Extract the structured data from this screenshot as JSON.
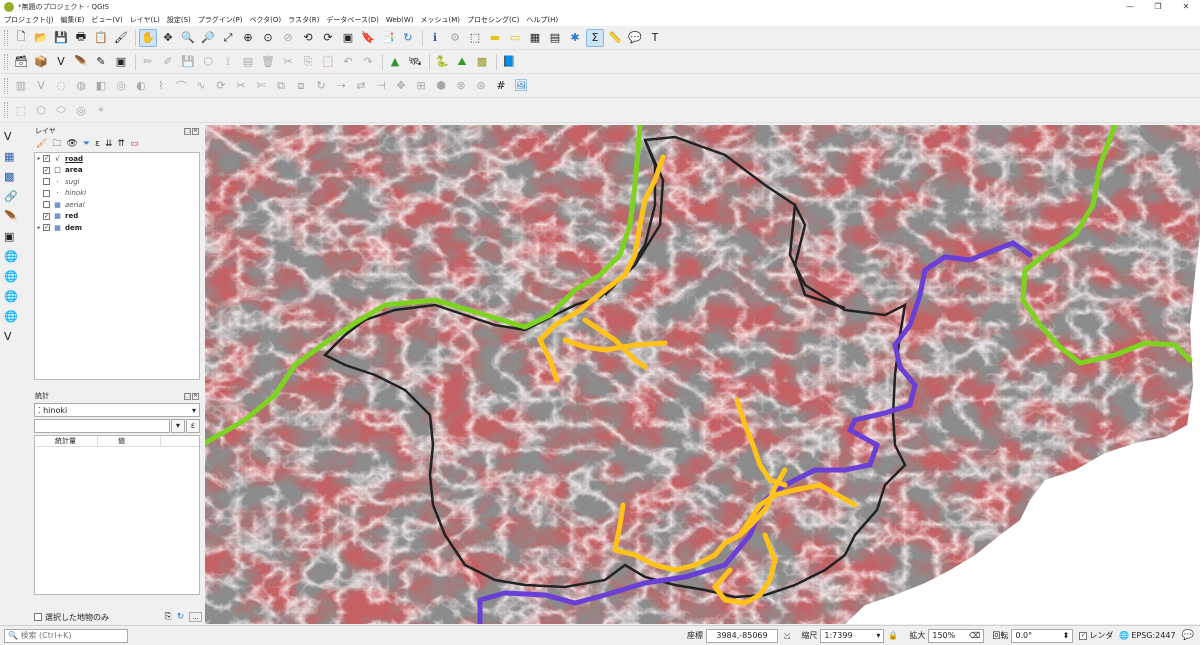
{
  "window": {
    "title": "*無題のプロジェクト - QGIS",
    "controls": [
      "—",
      "❐",
      "✕"
    ]
  },
  "menu": [
    "プロジェクト(J)",
    "編集(E)",
    "ビュー(V)",
    "レイヤ(L)",
    "設定(S)",
    "プラグイン(P)",
    "ベクタ(O)",
    "ラスタ(R)",
    "データベース(D)",
    "Web(W)",
    "メッシュ(M)",
    "プロセシング(C)",
    "ヘルプ(H)"
  ],
  "layers_panel": {
    "title": "レイヤ",
    "layers": [
      {
        "name": "road",
        "checked": true,
        "icon": "line-layer-icon",
        "style": "bold under",
        "expandable": true
      },
      {
        "name": "area",
        "checked": true,
        "icon": "polygon-layer-icon",
        "style": "bold",
        "expandable": false
      },
      {
        "name": "sugi",
        "checked": false,
        "icon": "point-layer-icon",
        "style": "italic",
        "expandable": false
      },
      {
        "name": "hinoki",
        "checked": false,
        "icon": "point-layer-icon",
        "style": "italic",
        "expandable": false
      },
      {
        "name": "aerial",
        "checked": false,
        "icon": "raster-layer-icon",
        "style": "italic",
        "expandable": false
      },
      {
        "name": "red",
        "checked": true,
        "icon": "raster-layer-icon",
        "style": "bold",
        "expandable": false
      },
      {
        "name": "dem",
        "checked": true,
        "icon": "raster-layer-icon",
        "style": "bold",
        "expandable": true
      }
    ]
  },
  "stats_panel": {
    "title": "統計",
    "selected_layer": "hinoki",
    "expr_button": "ε",
    "columns": [
      "統計量",
      "値"
    ],
    "selected_only_label": "選択した地物のみ",
    "more_button": "..."
  },
  "statusbar": {
    "search_placeholder": "検索 (Ctrl+K)",
    "coord_label": "座標",
    "coord_value": "3984,-85069",
    "scale_label": "縮尺",
    "scale_value": "1:7399",
    "magnifier_label": "拡大",
    "magnifier_value": "150%",
    "rotation_label": "回転",
    "rotation_value": "0.0°",
    "render_label": "レンダ",
    "crs_label": "EPSG:2447"
  },
  "map_colors": {
    "road_green": "#7ed321",
    "road_purple": "#6a3fd6",
    "road_orange": "#ffc21a",
    "area_outline": "#222222",
    "relief_red": "#a8262a"
  }
}
